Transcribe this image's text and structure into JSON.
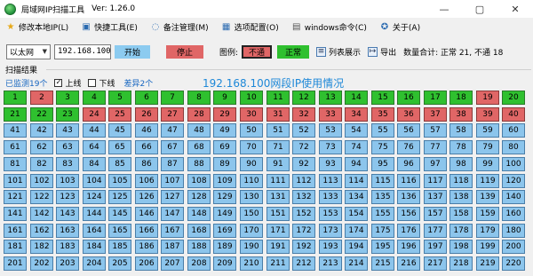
{
  "window": {
    "title": "局域网IP扫描工具",
    "version": "Ver: 1.26.0",
    "controls": [
      "—",
      "▢",
      "✕"
    ]
  },
  "menu": [
    {
      "label": "修改本地IP(L)",
      "icon": "star-icon"
    },
    {
      "label": "快捷工具(E)",
      "icon": "tools-icon"
    },
    {
      "label": "备注管理(M)",
      "icon": "comment-icon"
    },
    {
      "label": "选项配置(O)",
      "icon": "options-icon"
    },
    {
      "label": "windows命令(C)",
      "icon": "terminal-icon"
    },
    {
      "label": "关于(A)",
      "icon": "about-icon"
    }
  ],
  "toolbar": {
    "adapter": "以太网",
    "ip": "192.168.100",
    "start": "开始",
    "stop": "停止",
    "legend_label": "图例:",
    "legend_off": "不通",
    "legend_on": "正常",
    "list_view": "列表展示",
    "export": "导出",
    "count_text": "数量合计: 正常 21, 不通 18"
  },
  "group_title": "扫描结果",
  "status": {
    "monitored": "已监测19个",
    "online": "上线",
    "offline": "下线",
    "diff": "差异2个"
  },
  "segment_title": "192.168.100网段IP使用情况",
  "colors": {
    "online": "#2fc02f",
    "offline": "#e06666",
    "unscanned": "#8cc5ec"
  },
  "grid": {
    "columns": 20,
    "online": [
      1,
      3,
      4,
      5,
      6,
      7,
      8,
      9,
      10,
      11,
      12,
      13,
      14,
      15,
      16,
      17,
      18,
      20,
      21,
      22,
      23
    ],
    "offline": [
      2,
      19,
      24,
      25,
      26,
      27,
      28,
      29,
      30,
      31,
      32,
      33,
      34,
      35,
      36,
      37,
      38,
      39,
      40
    ],
    "shown": 220
  }
}
